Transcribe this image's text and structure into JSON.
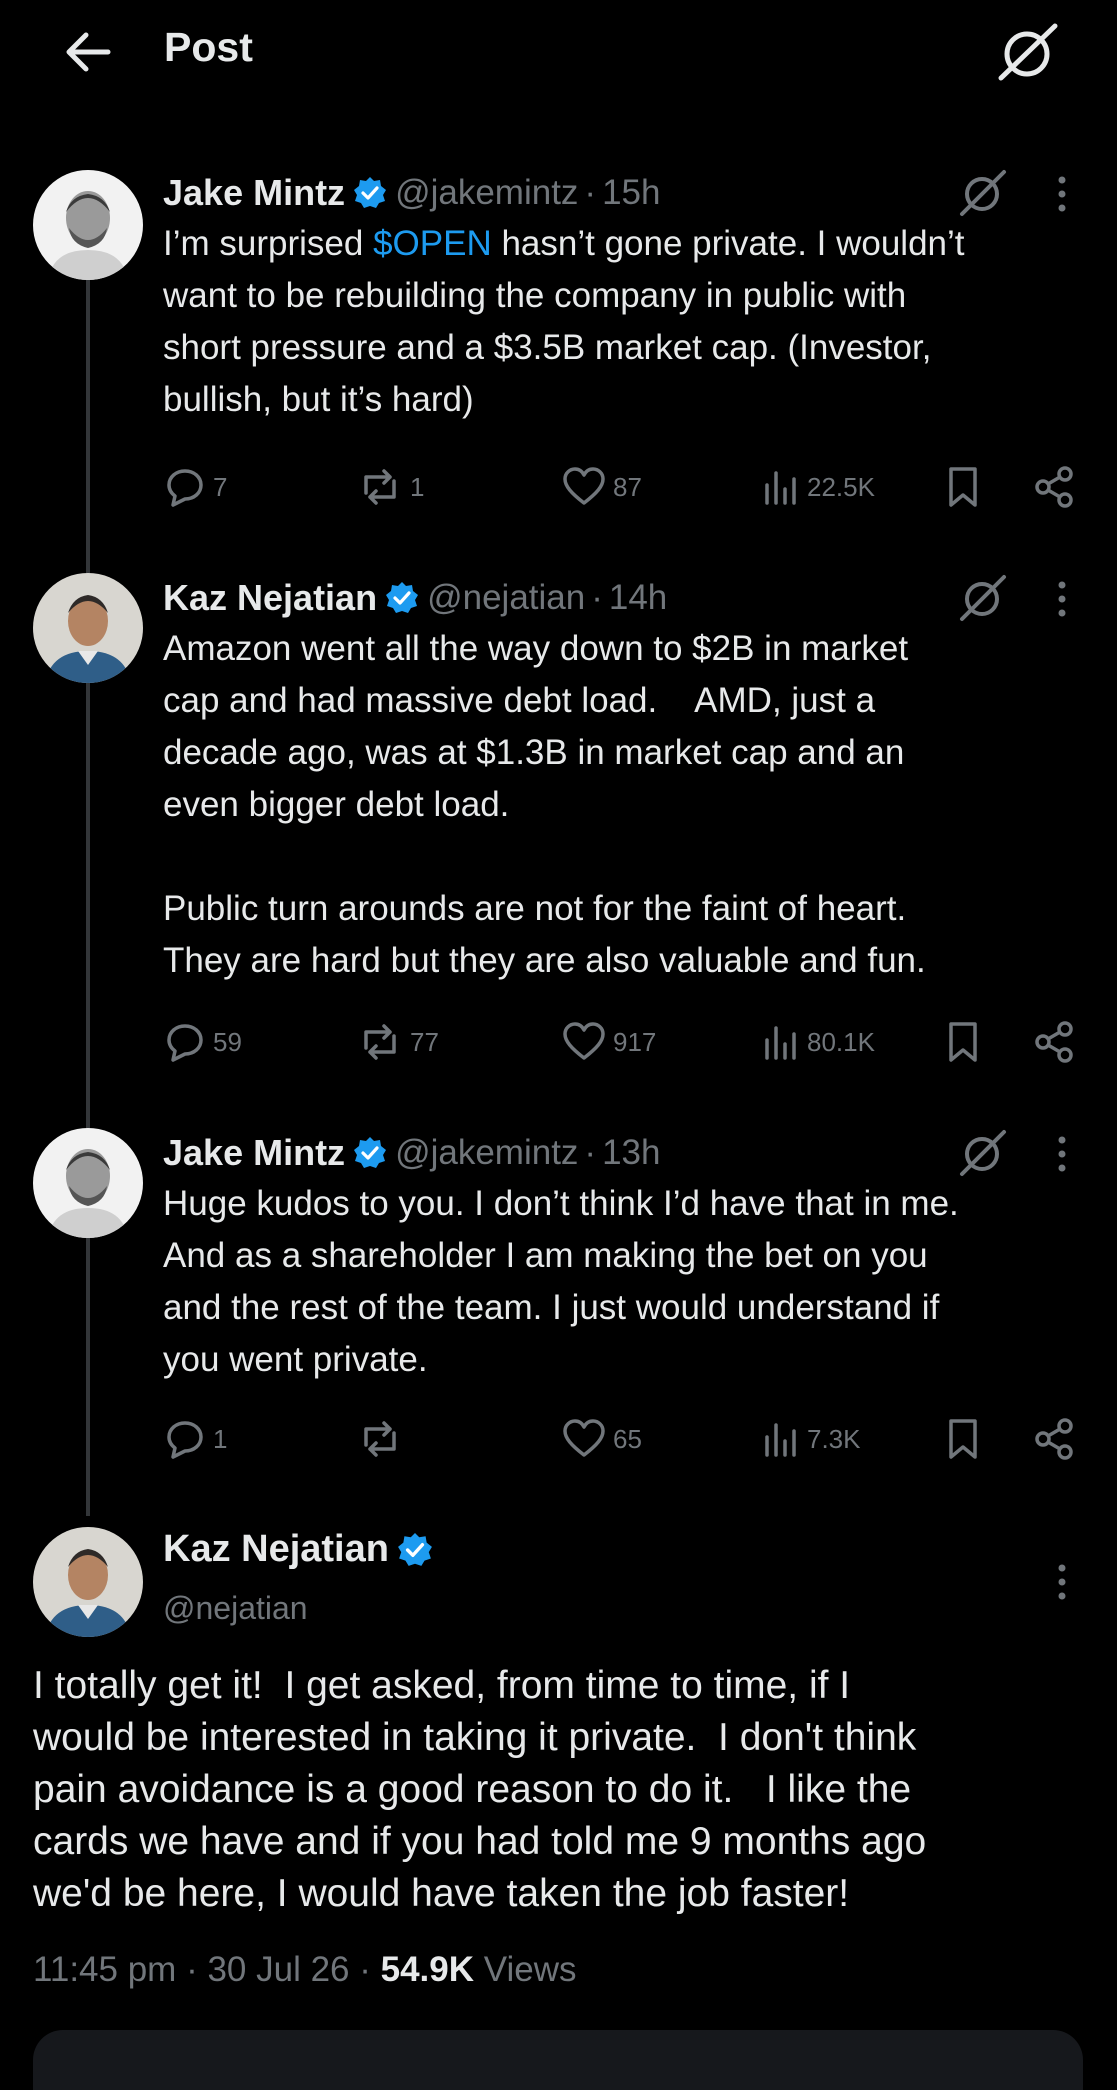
{
  "header": {
    "title": "Post",
    "back_icon": "arrow-left-icon",
    "grok_icon": "grok-icon"
  },
  "replies": [
    {
      "name": "Jake Mintz",
      "handle": "@jakemintz",
      "time": "15h",
      "text_before": "I’m surprised ",
      "cashtag": "$OPEN",
      "text_after": " hasn’t gone private. I wouldn’t\nwant to be rebuilding the company in public with\nshort pressure and a $3.5B market cap. (Investor,\nbullish, but it’s hard)",
      "stats": {
        "replies": "7",
        "reposts": "1",
        "likes": "87",
        "views": "22.5K"
      }
    },
    {
      "name": "Kaz Nejatian",
      "handle": "@nejatian",
      "time": "14h",
      "text": "Amazon went all the way down to $2B in market\ncap and had massive debt load.    AMD, just a\ndecade ago, was at $1.3B in market cap and an\neven bigger debt load.\n\nPublic turn arounds are not for the faint of heart.\nThey are hard but they are also valuable and fun.",
      "stats": {
        "replies": "59",
        "reposts": "77",
        "likes": "917",
        "views": "80.1K"
      }
    },
    {
      "name": "Jake Mintz",
      "handle": "@jakemintz",
      "time": "13h",
      "text": "Huge kudos to you. I don’t think I’d have that in me.\nAnd as a shareholder I am making the bet on you\nand the rest of the team. I just would understand if\nyou went private.",
      "stats": {
        "replies": "1",
        "reposts": "",
        "likes": "65",
        "views": "7.3K"
      }
    }
  ],
  "main_post": {
    "name": "Kaz Nejatian",
    "handle": "@nejatian",
    "text": "I totally get it!  I get asked, from time to time, if I\nwould be interested in taking it private.  I don't think\npain avoidance is a good reason to do it.   I like the\ncards we have and if you had told me 9 months ago\nwe'd be here, I would have taken the job faster!",
    "time": "11:45 pm",
    "date": "30 Jul 26",
    "views_count": "54.9K",
    "views_label": "Views"
  },
  "colors": {
    "background": "#000000",
    "text": "#e7e9ea",
    "muted": "#71767b",
    "accent": "#1d9bf0"
  }
}
